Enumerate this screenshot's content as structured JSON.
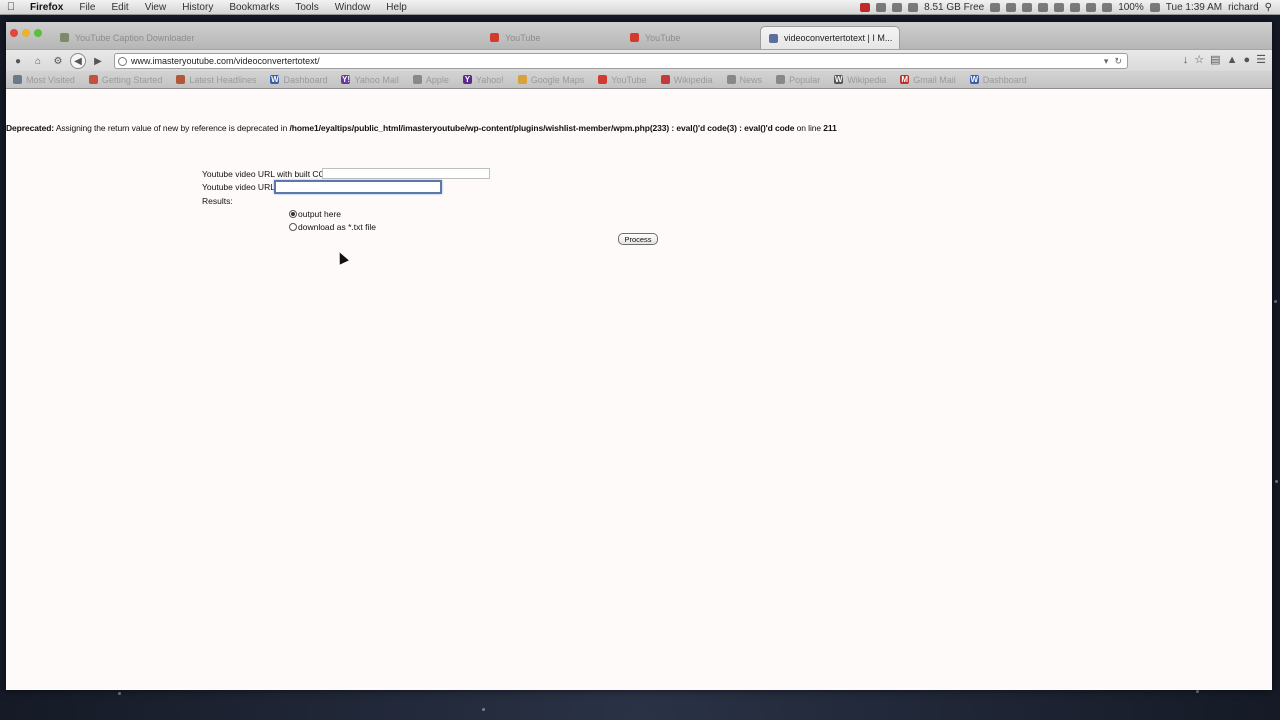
{
  "menubar": {
    "apple": "",
    "items": [
      "Firefox",
      "File",
      "Edit",
      "View",
      "History",
      "Bookmarks",
      "Tools",
      "Window",
      "Help"
    ],
    "storage": "8.51 GB Free",
    "battery": "100%",
    "clock": "Tue 1:39 AM",
    "user": "richard"
  },
  "browser": {
    "tabs": [
      {
        "label": "YouTube Caption Downloader",
        "color": "#7c8a6a",
        "active": false
      },
      {
        "label": "YouTube",
        "color": "#d23a30",
        "active": false
      },
      {
        "label": "YouTube",
        "color": "#d23a30",
        "active": false
      },
      {
        "label": "videoconvertertotext | I M...",
        "color": "#5a6f9a",
        "active": true
      }
    ],
    "url": "www.imasteryoutube.com/videoconvertertotext/",
    "bookmarks": [
      {
        "label": "Most Visited",
        "color": "#6a7a8a",
        "glyph": ""
      },
      {
        "label": "Getting Started",
        "color": "#c4523a",
        "glyph": ""
      },
      {
        "label": "Latest Headlines",
        "color": "#b0583a",
        "glyph": ""
      },
      {
        "label": "Dashboard",
        "color": "#3a5ea8",
        "glyph": "W"
      },
      {
        "label": "Yahoo Mail",
        "color": "#6a3a9a",
        "glyph": "Y!"
      },
      {
        "label": "Apple",
        "color": "#888888",
        "glyph": ""
      },
      {
        "label": "Yahoo!",
        "color": "#5b2a90",
        "glyph": "Y"
      },
      {
        "label": "Google Maps",
        "color": "#d7a23a",
        "glyph": ""
      },
      {
        "label": "YouTube",
        "color": "#d23a30",
        "glyph": ""
      },
      {
        "label": "Wikipedia",
        "color": "#c23a3a",
        "glyph": ""
      },
      {
        "label": "News",
        "color": "#888888",
        "glyph": ""
      },
      {
        "label": "Popular",
        "color": "#888888",
        "glyph": ""
      },
      {
        "label": "Wikipedia",
        "color": "#555555",
        "glyph": "W"
      },
      {
        "label": "Gmail Mail",
        "color": "#b8342a",
        "glyph": "M"
      },
      {
        "label": "Dashboard",
        "color": "#3a5ea8",
        "glyph": "W"
      }
    ]
  },
  "page": {
    "deprecated_label": "Deprecated:",
    "deprecated_text": " Assigning the return value of new by reference is deprecated in ",
    "deprecated_path": "/home1/eyaltips/public_html/imasteryoutube/wp-content/plugins/wishlist-member/wpm.php(233) : eval()'d code(3) : eval()'d code",
    "deprecated_line_label": " on line ",
    "deprecated_line": "211",
    "field1_label": "Youtube video URL with built CC:",
    "field1_value": "",
    "field2_label": "Youtube video URL:",
    "field2_value": "",
    "results_label": "Results:",
    "radio_output": "output here",
    "radio_download": "download as *.txt file",
    "process_button": "Process"
  }
}
